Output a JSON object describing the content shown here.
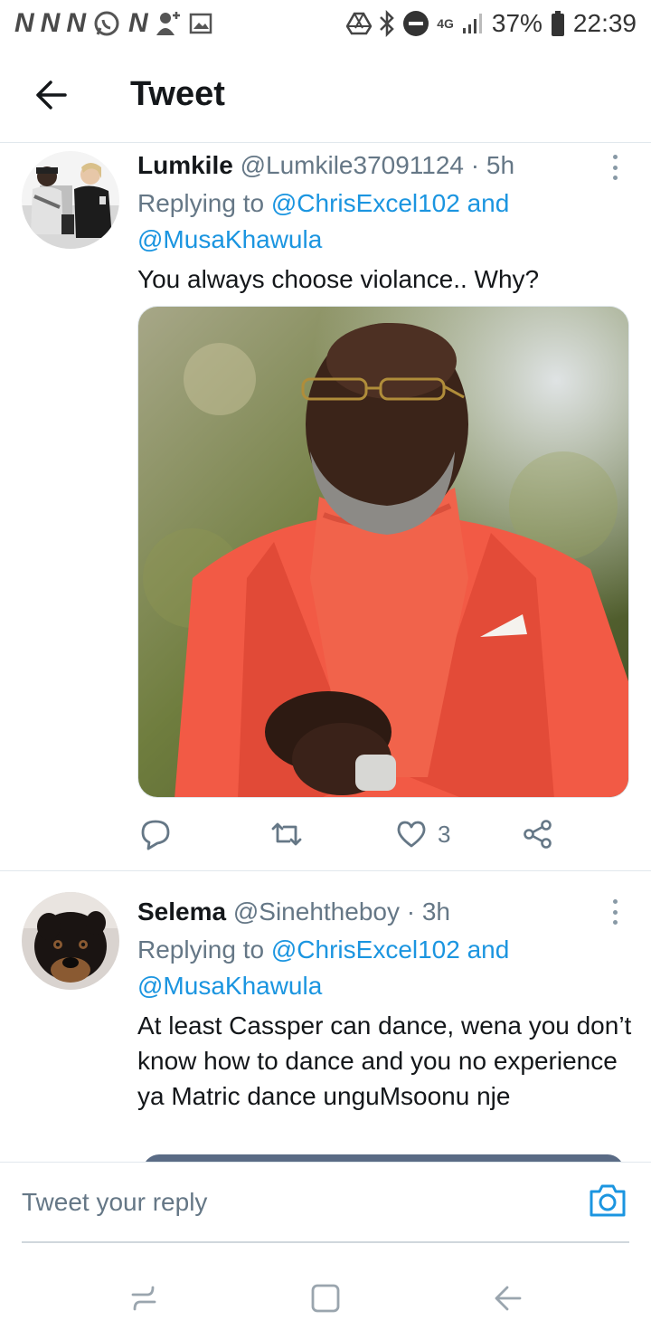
{
  "status_bar": {
    "notification_letters": [
      "N",
      "N",
      "N",
      "N"
    ],
    "network": "4G",
    "battery": "37%",
    "time": "22:39"
  },
  "header": {
    "title": "Tweet"
  },
  "tweets": [
    {
      "name": "Lumkile",
      "handle": "@Lumkile37091124",
      "separator": "·",
      "time": "5h",
      "replying_prefix": "Replying to ",
      "mention1": "@ChrisExcel102",
      "and_word": " and",
      "mention2": "@MusaKhawula",
      "text": "You always choose violance.. Why?",
      "likes": "3"
    },
    {
      "name": "Selema",
      "handle": "@Sinehtheboy",
      "separator": "·",
      "time": "3h",
      "replying_prefix": "Replying to ",
      "mention1": "@ChrisExcel102",
      "and_word": " and",
      "mention2": "@MusaKhawula",
      "text": "At least Cassper can dance, wena you don’t know how to dance and you no experience ya Matric dance unguMsoonu nje"
    }
  ],
  "reply": {
    "placeholder": "Tweet your reply"
  },
  "icons": {
    "back": "arrow-left-icon",
    "more": "more-vertical-icon",
    "reply": "reply-bubble-icon",
    "retweet": "retweet-icon",
    "like": "heart-icon",
    "share": "share-icon",
    "camera": "camera-icon"
  },
  "colors": {
    "accent": "#1b95e0",
    "secondary_text": "#657786",
    "primary_text": "#14171a"
  }
}
